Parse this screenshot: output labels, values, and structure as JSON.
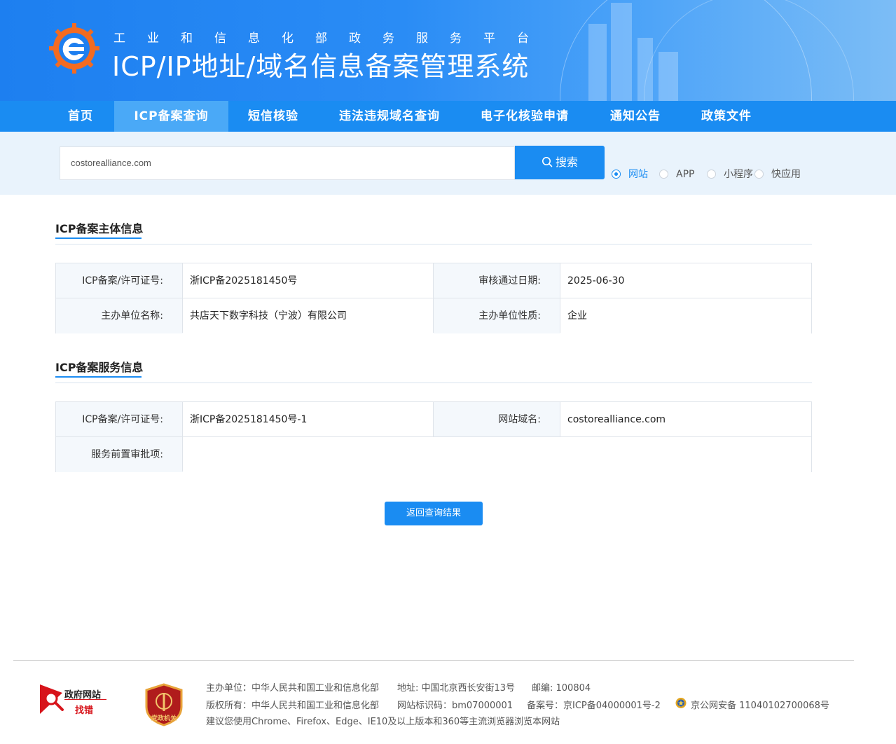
{
  "header": {
    "subtitle": "工业和信息化部政务服务平台",
    "title": "ICP/IP地址/域名信息备案管理系统"
  },
  "nav": [
    {
      "label": "首页"
    },
    {
      "label": "ICP备案查询"
    },
    {
      "label": "短信核验"
    },
    {
      "label": "违法违规域名查询"
    },
    {
      "label": "电子化核验申请"
    },
    {
      "label": "通知公告"
    },
    {
      "label": "政策文件"
    }
  ],
  "search": {
    "value": "costorealliance.com",
    "button_label": "搜索",
    "types": [
      "网站",
      "APP",
      "小程序",
      "快应用"
    ],
    "selected": "网站"
  },
  "subject_info": {
    "heading": "ICP备案主体信息",
    "license_label": "ICP备案/许可证号:",
    "license_value": "浙ICP备2025181450号",
    "date_label": "审核通过日期:",
    "date_value": "2025-06-30",
    "org_label": "主办单位名称:",
    "org_value": "共店天下数字科技（宁波）有限公司",
    "org_type_label": "主办单位性质:",
    "org_type_value": "企业"
  },
  "service_info": {
    "heading": "ICP备案服务信息",
    "license_label": "ICP备案/许可证号:",
    "license_value": "浙ICP备2025181450号-1",
    "domain_label": "网站域名:",
    "domain_value": "costorealliance.com",
    "approval_label": "服务前置审批项:",
    "approval_value": ""
  },
  "back_button": "返回查询结果",
  "footer": {
    "gov_badge_line1": "政府网站",
    "gov_badge_line2": "找错",
    "party_badge": "党政机关",
    "sponsor": "主办单位：中华人民共和国工业和信息化部",
    "address": "地址: 中国北京西长安街13号",
    "postcode": "邮编: 100804",
    "copyright": "版权所有：中华人民共和国工业和信息化部",
    "site_id": "网站标识码：bm07000001",
    "icp": "备案号：京ICP备04000001号-2",
    "police": "京公网安备 11040102700068号",
    "browser_tip": "建议您使用Chrome、Firefox、Edge、IE10及以上版本和360等主流浏览器浏览本网站"
  },
  "colors": {
    "primary": "#1a8cf2",
    "nav_active": "#4aa9f7",
    "label_bg": "#f4f8fc"
  }
}
